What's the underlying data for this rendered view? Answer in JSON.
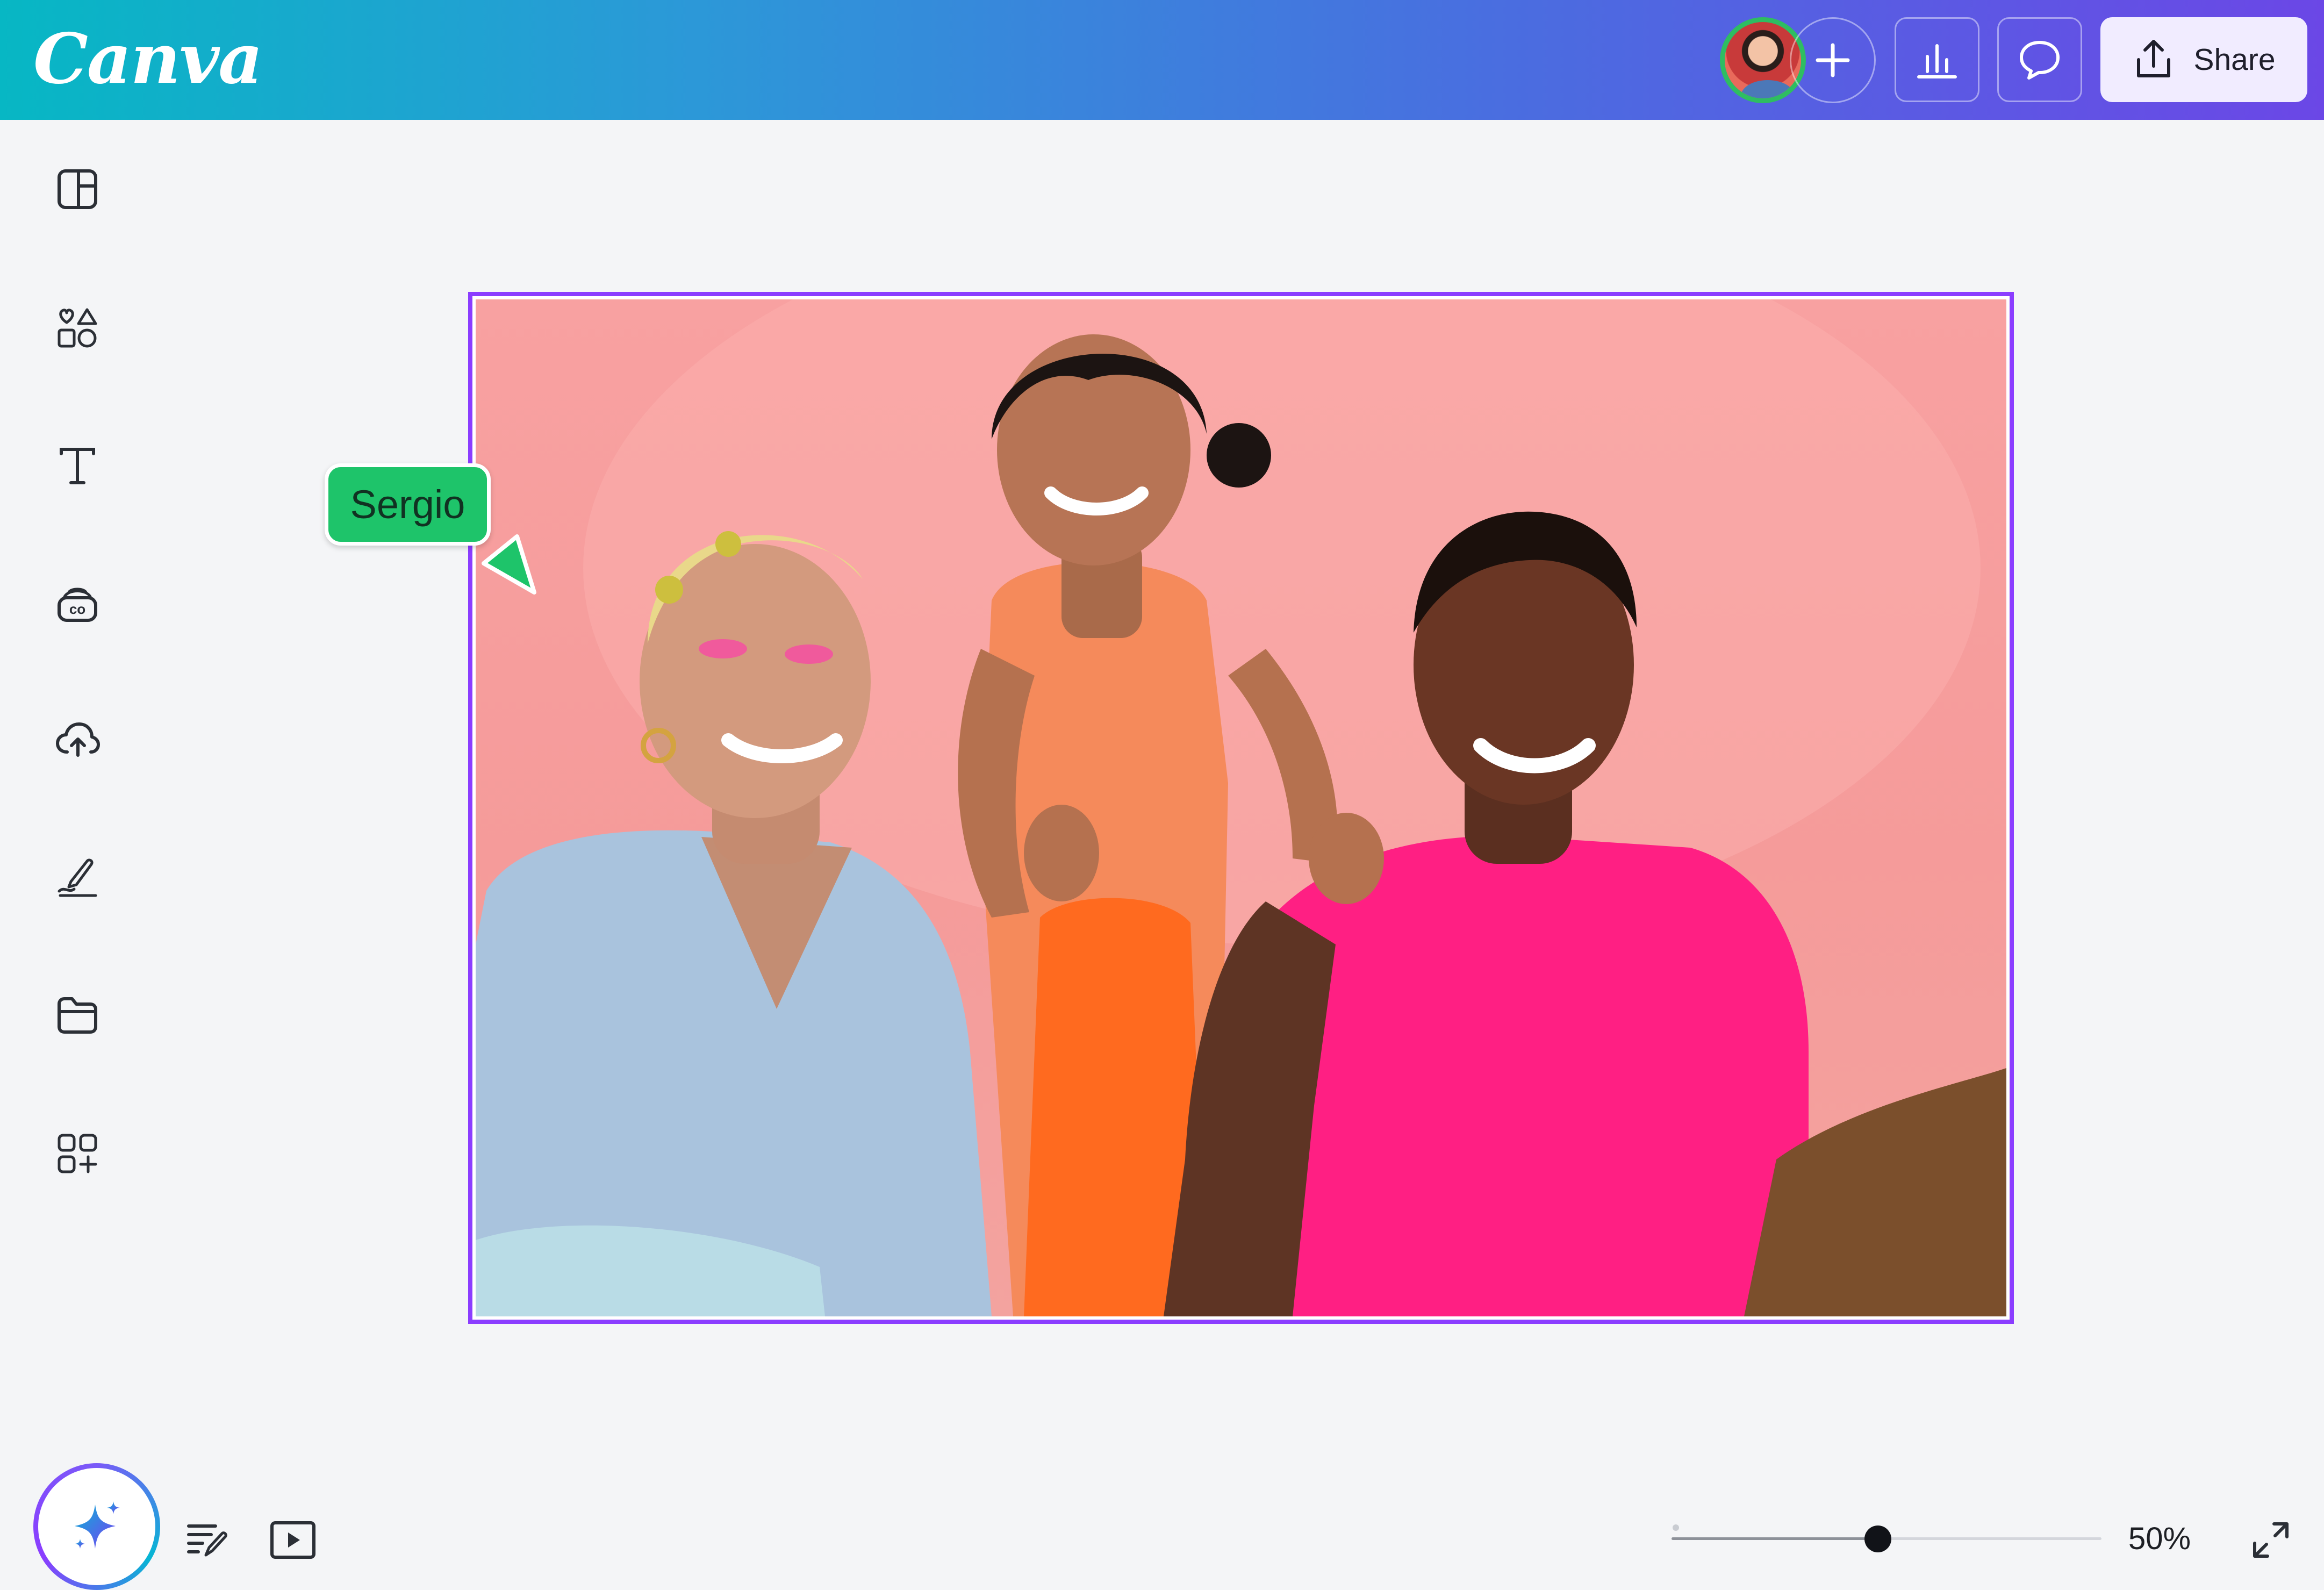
{
  "header": {
    "logo_text": "Canva",
    "share_label": "Share",
    "buttons": [
      {
        "name": "add-collaborator",
        "icon": "plus-icon"
      },
      {
        "name": "insights",
        "icon": "bar-chart-icon"
      },
      {
        "name": "comments",
        "icon": "comment-icon"
      }
    ]
  },
  "sidebar": {
    "items": [
      {
        "name": "design",
        "icon": "layout-icon"
      },
      {
        "name": "elements",
        "icon": "shapes-icon"
      },
      {
        "name": "text",
        "icon": "text-icon"
      },
      {
        "name": "brand",
        "icon": "brand-kit-icon"
      },
      {
        "name": "uploads",
        "icon": "cloud-upload-icon"
      },
      {
        "name": "draw",
        "icon": "draw-icon"
      },
      {
        "name": "projects",
        "icon": "folder-icon"
      },
      {
        "name": "apps",
        "icon": "apps-icon"
      }
    ]
  },
  "canvas": {
    "collaborator_name": "Sergio",
    "collaborator_color": "#1ec46a",
    "selection_color": "#8b3dff"
  },
  "bottom_bar": {
    "zoom_label": "50%",
    "zoom_fraction": 0.48
  }
}
